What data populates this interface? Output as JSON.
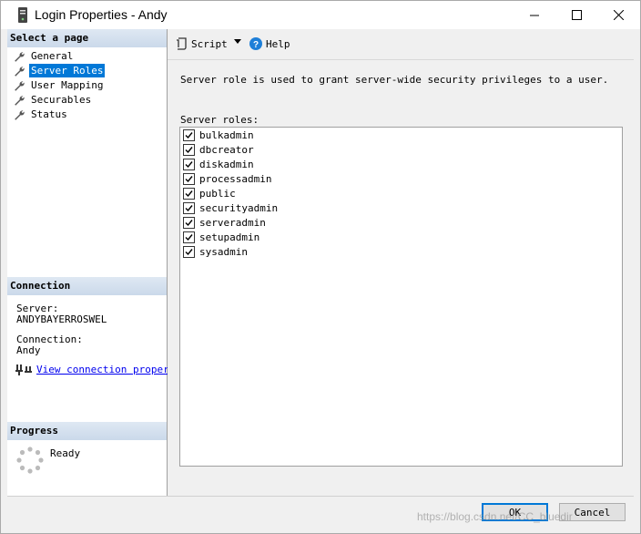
{
  "window": {
    "title": "Login Properties - Andy"
  },
  "sidebar": {
    "select_page_header": "Select a page",
    "pages": [
      {
        "label": "General",
        "selected": false
      },
      {
        "label": "Server Roles",
        "selected": true
      },
      {
        "label": "User Mapping",
        "selected": false
      },
      {
        "label": "Securables",
        "selected": false
      },
      {
        "label": "Status",
        "selected": false
      }
    ],
    "connection_header": "Connection",
    "server_label": "Server:",
    "server_value": "ANDYBAYERROSWEL",
    "connection_label": "Connection:",
    "connection_value": "Andy",
    "view_connection_link": "View connection properti",
    "progress_header": "Progress",
    "progress_status": "Ready"
  },
  "toolbar": {
    "script_label": "Script",
    "help_label": "Help"
  },
  "content": {
    "description": "Server role is used to grant server-wide security privileges to a user.",
    "roles_label": "Server roles:",
    "roles": [
      {
        "name": "bulkadmin",
        "checked": true
      },
      {
        "name": "dbcreator",
        "checked": true
      },
      {
        "name": "diskadmin",
        "checked": true
      },
      {
        "name": "processadmin",
        "checked": true
      },
      {
        "name": "public",
        "checked": true
      },
      {
        "name": "securityadmin",
        "checked": true
      },
      {
        "name": "serveradmin",
        "checked": true
      },
      {
        "name": "setupadmin",
        "checked": true
      },
      {
        "name": "sysadmin",
        "checked": true
      }
    ]
  },
  "footer": {
    "ok_label": "OK",
    "cancel_label": "Cancel"
  },
  "watermark": "https://blog.csdn.net/CC_bluedir",
  "colors": {
    "selection": "#0078d7",
    "link": "#0000ee",
    "header_gradient_top": "#dfe8f3",
    "header_gradient_bottom": "#cbd9ea"
  }
}
